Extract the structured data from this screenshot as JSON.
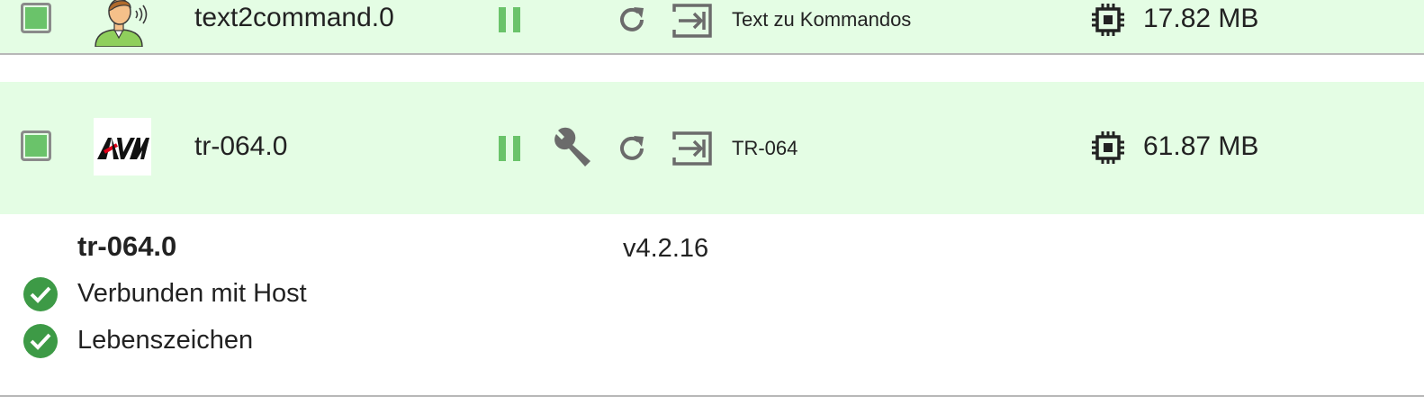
{
  "instances": [
    {
      "name": "text2command.0",
      "title": "Text zu Kommandos",
      "memory": "17.82 MB",
      "icons": [
        "checkbox",
        "person-speaking-icon",
        "pause-icon",
        "reload-icon",
        "log-icon",
        "chip-icon"
      ]
    },
    {
      "name": "tr-064.0",
      "title": "TR-064",
      "memory": "61.87 MB",
      "logo_text": "AVM",
      "icons": [
        "checkbox",
        "avm-logo",
        "pause-icon",
        "wrench-icon",
        "reload-icon",
        "log-icon",
        "chip-icon"
      ]
    }
  ],
  "details": {
    "name": "tr-064.0",
    "version": "v4.2.16",
    "statuses": [
      {
        "label": "Verbunden mit Host",
        "icon": "check-circle-icon"
      },
      {
        "label": "Lebenszeichen",
        "icon": "check-circle-icon"
      }
    ]
  },
  "colors": {
    "row_bg": "#e4fde4",
    "accent_green": "#6ac36a",
    "icon_gray": "#6b6b6b",
    "check_green": "#3d9a46",
    "avm_red": "#e2001a"
  }
}
